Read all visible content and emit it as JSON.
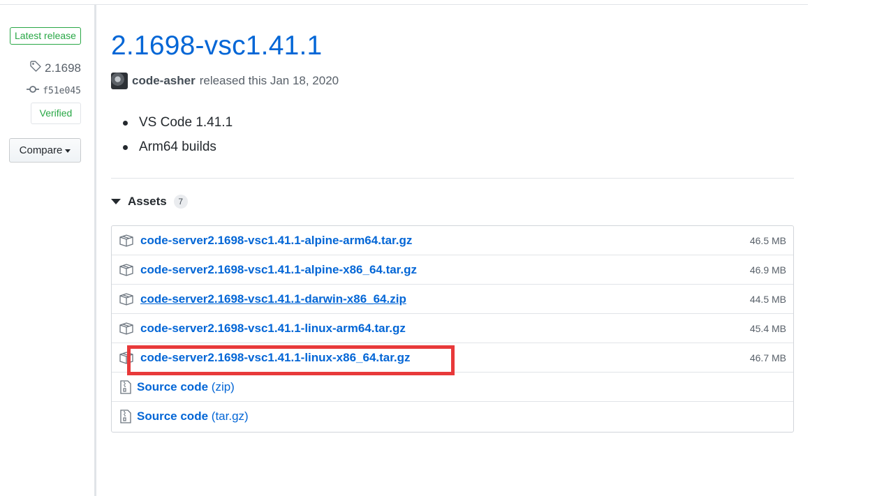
{
  "sidebar": {
    "latest_badge": "Latest release",
    "tag": "2.1698",
    "commit": "f51e045",
    "verified": "Verified",
    "compare_label": "Compare"
  },
  "release": {
    "title": "2.1698-vsc1.41.1",
    "author": "code-asher",
    "released_text": "released this Jan 18, 2020",
    "notes": [
      "VS Code 1.41.1",
      "Arm64 builds"
    ]
  },
  "assets": {
    "label": "Assets",
    "count": "7",
    "files": [
      {
        "name": "code-server2.1698-vsc1.41.1-alpine-arm64.tar.gz",
        "size": "46.5 MB"
      },
      {
        "name": "code-server2.1698-vsc1.41.1-alpine-x86_64.tar.gz",
        "size": "46.9 MB"
      },
      {
        "name": "code-server2.1698-vsc1.41.1-darwin-x86_64.zip",
        "size": "44.5 MB"
      },
      {
        "name": "code-server2.1698-vsc1.41.1-linux-arm64.tar.gz",
        "size": "45.4 MB"
      },
      {
        "name": "code-server2.1698-vsc1.41.1-linux-x86_64.tar.gz",
        "size": "46.7 MB"
      }
    ],
    "source": [
      {
        "label": "Source code",
        "ext": "(zip)"
      },
      {
        "label": "Source code",
        "ext": "(tar.gz)"
      }
    ]
  },
  "colors": {
    "link": "#0366d6",
    "badge_green": "#28a745",
    "highlight_red": "#e8393a"
  }
}
